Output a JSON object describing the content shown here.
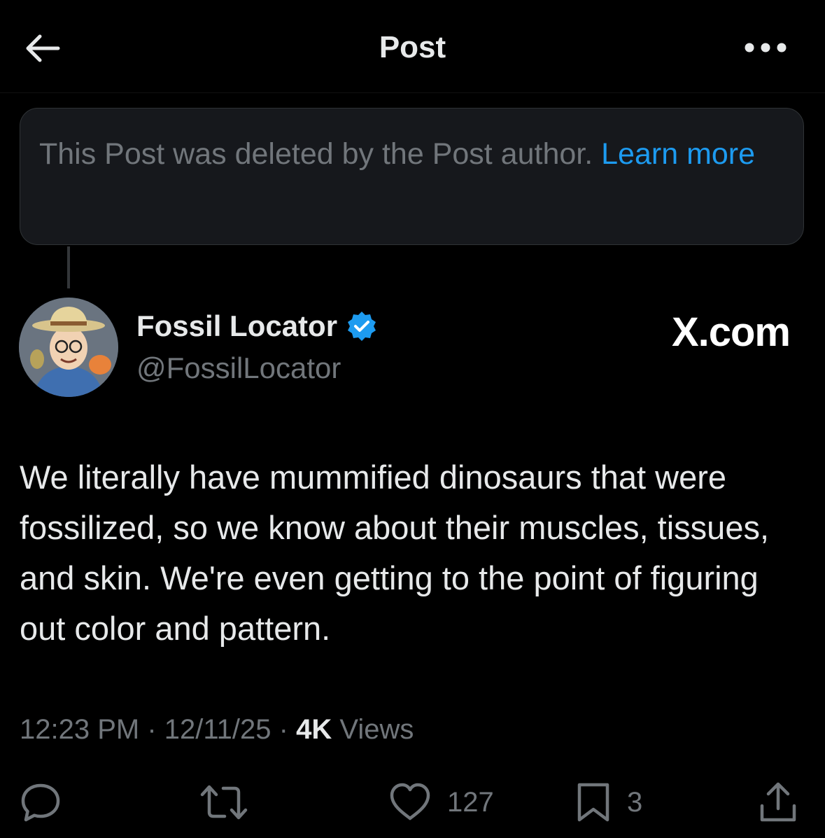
{
  "header": {
    "title": "Post",
    "back_icon": "arrow-left-icon",
    "more_icon": "more-horizontal-icon"
  },
  "deleted_notice": {
    "text": "This Post was deleted by the Post author.",
    "link_label": "Learn more"
  },
  "post": {
    "author": {
      "name": "Fossil Locator",
      "handle": "@FossilLocator",
      "verified": true,
      "verified_color": "#1d9bf0"
    },
    "watermark": "X.com",
    "text": "We literally have mummified dinosaurs that were fossilized, so we know about their muscles, tissues, and skin. We're even getting to the point of figuring out color and pattern.",
    "time": "12:23 PM",
    "separator": "·",
    "date": "12/11/25",
    "views_count": "4K",
    "views_label": "Views"
  },
  "actions": {
    "reply": {
      "icon": "reply-icon",
      "count": ""
    },
    "repost": {
      "icon": "repost-icon",
      "count": ""
    },
    "like": {
      "icon": "heart-icon",
      "count": "127"
    },
    "bookmark": {
      "icon": "bookmark-icon",
      "count": "3"
    },
    "share": {
      "icon": "share-icon",
      "count": ""
    }
  },
  "colors": {
    "background": "#000000",
    "text_primary": "#e7e9ea",
    "text_secondary": "#71767b",
    "link": "#1d9bf0",
    "notice_bg": "#16181c",
    "border": "#2f3336"
  }
}
